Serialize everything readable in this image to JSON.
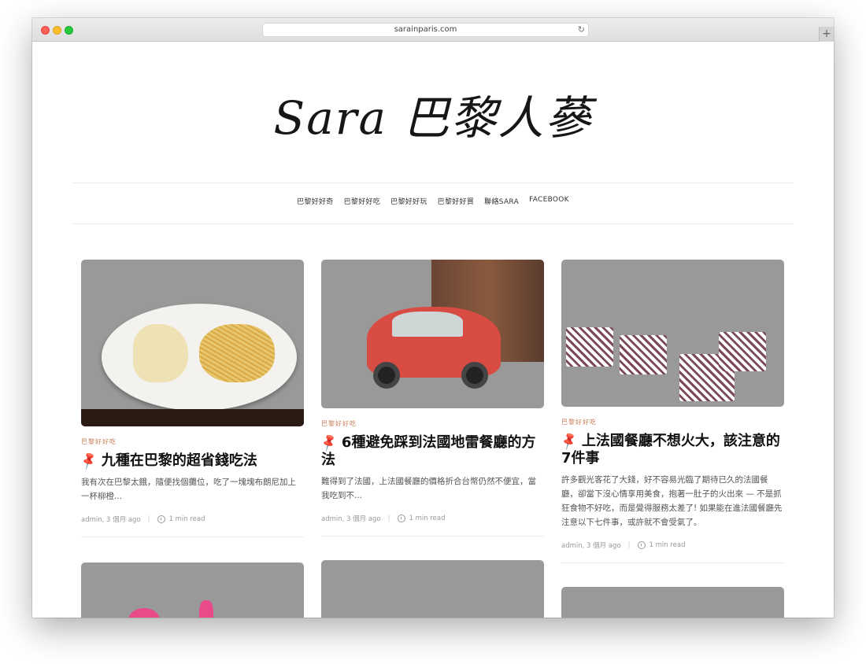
{
  "browser": {
    "url": "sarainparis.com",
    "reload_icon": "reload-icon",
    "newtab_label": "+"
  },
  "site": {
    "logo_text": "Sara 巴黎人蔘"
  },
  "nav": {
    "items": [
      "巴黎好好奇",
      "巴黎好好吃",
      "巴黎好好玩",
      "巴黎好好買",
      "聯絡SARA",
      "FACEBOOK"
    ]
  },
  "posts": [
    {
      "category": "巴黎好好吃",
      "title": "九種在巴黎的超省錢吃法",
      "excerpt": "我有次在巴黎太餓，隨便找個攤位，吃了一塊塊布朗尼加上一杯柳橙...",
      "author_date": "admin, 3 個月 ago",
      "read_time": "1 min read",
      "image": "food-plate-photo"
    },
    {
      "category": "巴黎好好吃",
      "title": "6種避免踩到法國地雷餐廳的方法",
      "excerpt": "難得到了法國，上法國餐廳的價格折合台幣仍然不便宜，當我吃到不...",
      "author_date": "admin, 3 個月 ago",
      "read_time": "1 min read",
      "image": "red-car-photo"
    },
    {
      "category": "巴黎好好吃",
      "title": "上法國餐廳不想火大，該注意的7件事",
      "excerpt": "許多觀光客花了大錢，好不容易光臨了期待已久的法國餐廳，卻當下沒心情享用美食，抱著一肚子的火出來 — 不是抓狂食物不好吃，而是覺得服務太差了! 如果能在進法國餐廳先注意以下七件事，或許就不會受氣了。",
      "author_date": "admin, 3 個月 ago",
      "read_time": "1 min read",
      "image": "cafe-terrace-photo"
    }
  ],
  "colors": {
    "category": "#c97c59",
    "pin": "#b85b3a"
  }
}
